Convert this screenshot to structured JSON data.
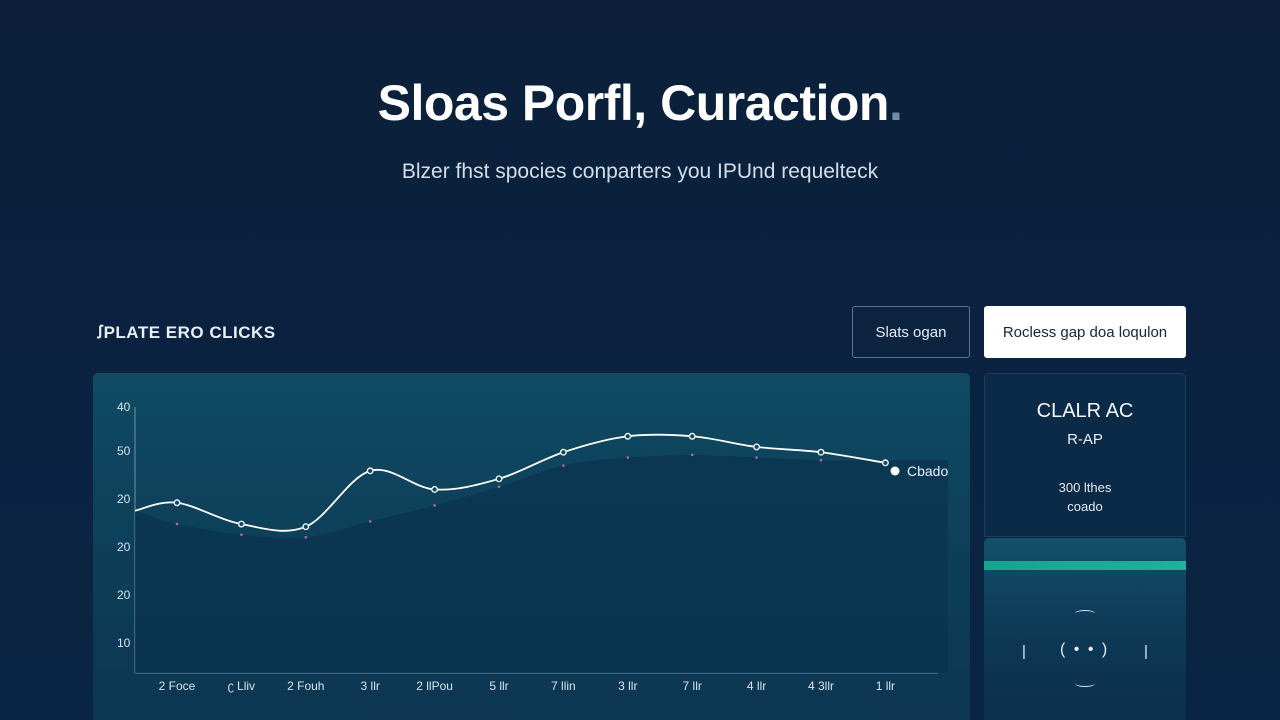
{
  "hero": {
    "title": "Sloas Porfl, Curaction",
    "title_dot": ".",
    "subtitle": "Blzer fhst spocies conparters you IPUnd requelteck"
  },
  "section": {
    "label": "ꭍPLATE ERO CLICKS"
  },
  "buttons": {
    "outline_label": "Slats ogan",
    "solid_label": "Rocless gap doa loqulon"
  },
  "side_card": {
    "title": "CLALR AC",
    "subtitle": "R-AP",
    "stat": "300 lthes",
    "stat_sub": "coado"
  },
  "player": {
    "progress": 1.0,
    "icons": [
      "skip-back-icon",
      "play-icon",
      "skip-forward-icon"
    ],
    "play_glyph": "( • • )",
    "skip_back_glyph": "|",
    "skip_fwd_glyph": "|"
  },
  "colors": {
    "background": "#0b1f38",
    "panel": "#0f4a63",
    "line": "#ffffff",
    "accent": "#1fb39b"
  },
  "chart_data": {
    "type": "line",
    "title": "",
    "xlabel": "",
    "ylabel": "",
    "x_tick_labels": [
      "2 Foce",
      "ʗ Lliv",
      "2 Fouh",
      "3 llr",
      "2 llPou",
      "5 llr",
      "7 llin",
      "3 llr",
      "7 llr",
      "4 llr",
      "4 3llr",
      "1 llr"
    ],
    "y_tick_labels": [
      "40",
      "50",
      "20",
      "20",
      "20",
      "10"
    ],
    "ylim": [
      0,
      50
    ],
    "grid": false,
    "legend_position": "right",
    "legend": [
      "Cbado"
    ],
    "series": [
      {
        "name": "Cbado",
        "color": "#ffffff",
        "values": [
          32,
          28,
          27.5,
          38,
          34.5,
          36.5,
          41.5,
          44.5,
          44.5,
          42.5,
          41.5,
          39.5
        ]
      }
    ],
    "area_values": [
      28,
      26,
      25.5,
      28.5,
      31.5,
      35,
      39,
      40.5,
      41,
      40.5,
      40,
      40
    ],
    "start_value": 30.5
  }
}
